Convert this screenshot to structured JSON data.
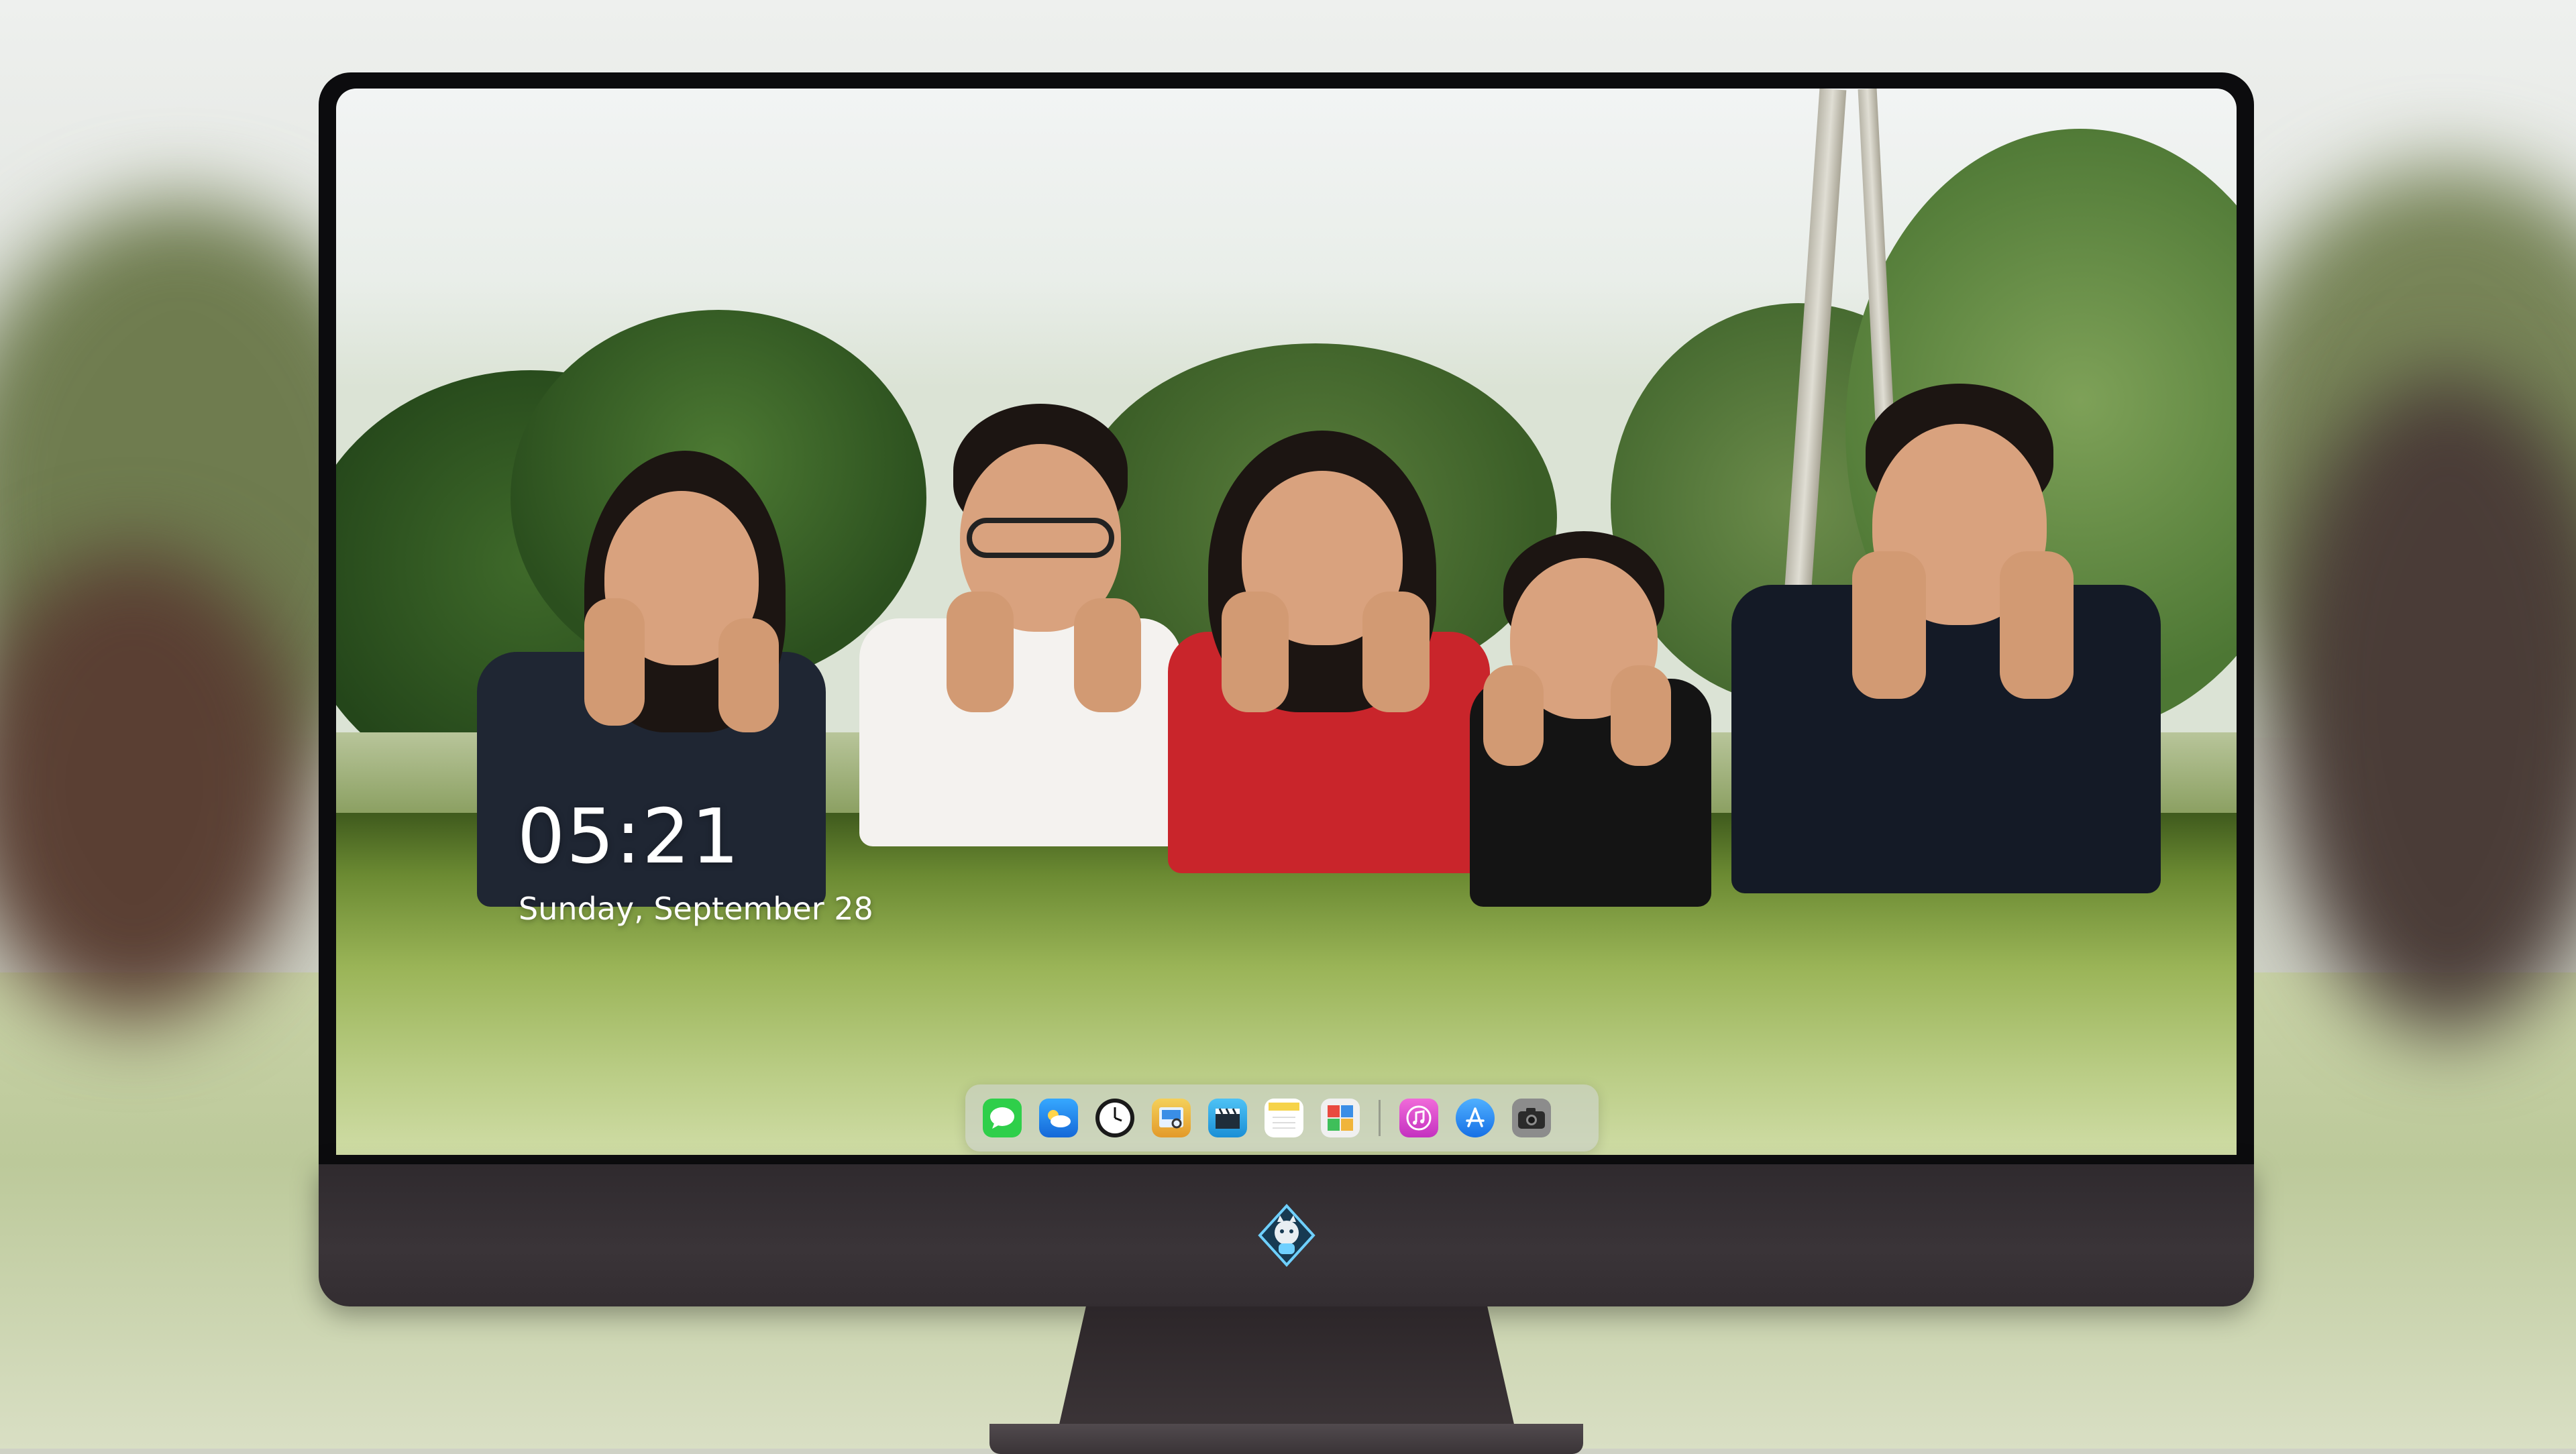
{
  "lock_screen": {
    "time": "05:21",
    "date": "Sunday, September 28"
  },
  "dock": {
    "apps": [
      {
        "name": "messages-icon",
        "color": "#2fcf4a"
      },
      {
        "name": "weather-icon",
        "color": "#1e8cf0"
      },
      {
        "name": "clock-icon",
        "color": "#1a1a1a"
      },
      {
        "name": "preview-icon",
        "color": "#e9b23a"
      },
      {
        "name": "video-clapper-icon",
        "color": "#2aa7e0"
      },
      {
        "name": "notes-icon",
        "color": "#f6d34a"
      },
      {
        "name": "photo-editor-icon",
        "color": "#f0f0f0"
      },
      {
        "name": "music-icon",
        "color": "#e03ec4"
      },
      {
        "name": "app-store-icon",
        "color": "#1a8ef2"
      },
      {
        "name": "camera-icon",
        "color": "#8c8c8c"
      }
    ]
  },
  "monitor": {
    "logo": "shield-mascot-logo"
  }
}
